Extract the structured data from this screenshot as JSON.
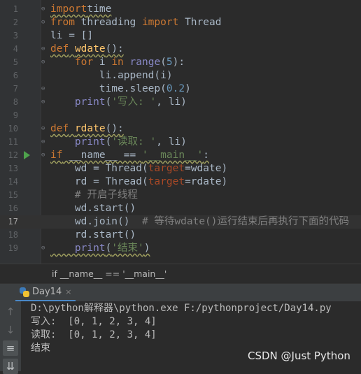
{
  "editor": {
    "lines": [
      {
        "n": "1",
        "segs": [
          [
            "kw",
            "import"
          ],
          [
            "",
            "time"
          ]
        ],
        "fold": true,
        "wavy": true
      },
      {
        "n": "2",
        "segs": [
          [
            "kw",
            "from"
          ],
          [
            "",
            " threading "
          ],
          [
            "kw",
            "import"
          ],
          [
            "",
            " Thread"
          ]
        ],
        "fold": true
      },
      {
        "n": "3",
        "segs": [
          [
            "",
            "li = []"
          ]
        ]
      },
      {
        "n": "4",
        "segs": [
          [
            "kw",
            "def"
          ],
          [
            "",
            " "
          ],
          [
            "fn",
            "wdate"
          ],
          [
            "",
            "():"
          ]
        ],
        "fold": true,
        "wavy": true
      },
      {
        "n": "5",
        "segs": [
          [
            "",
            "    "
          ],
          [
            "kw",
            "for"
          ],
          [
            "",
            " i "
          ],
          [
            "kw",
            "in"
          ],
          [
            "",
            " "
          ],
          [
            "bi",
            "range"
          ],
          [
            "",
            "("
          ],
          [
            "num",
            "5"
          ],
          [
            "",
            "):"
          ]
        ],
        "fold": true
      },
      {
        "n": "6",
        "segs": [
          [
            "",
            "        li.append(i)"
          ]
        ]
      },
      {
        "n": "7",
        "segs": [
          [
            "",
            "        time.sleep("
          ],
          [
            "num",
            "0.2"
          ],
          [
            "",
            ")"
          ]
        ],
        "fold": true
      },
      {
        "n": "8",
        "segs": [
          [
            "",
            "    "
          ],
          [
            "bi",
            "print"
          ],
          [
            "",
            "("
          ],
          [
            "str",
            "'写入: '"
          ],
          [
            "",
            ", li)"
          ]
        ],
        "fold": true
      },
      {
        "n": "9",
        "segs": []
      },
      {
        "n": "10",
        "segs": [
          [
            "kw",
            "def"
          ],
          [
            "",
            " "
          ],
          [
            "fn",
            "rdate"
          ],
          [
            "",
            "():"
          ]
        ],
        "fold": true,
        "wavy": true
      },
      {
        "n": "11",
        "segs": [
          [
            "",
            "    "
          ],
          [
            "bi",
            "print"
          ],
          [
            "",
            "("
          ],
          [
            "str",
            "'读取: '"
          ],
          [
            "",
            ", li)"
          ]
        ],
        "fold": true
      },
      {
        "n": "12",
        "segs": [
          [
            "kw",
            "if"
          ],
          [
            "",
            " __name__ == "
          ],
          [
            "str",
            "'__main__'"
          ],
          [
            "",
            ":"
          ]
        ],
        "fold": true,
        "wavy": true,
        "run": true
      },
      {
        "n": "13",
        "segs": [
          [
            "",
            "    wd = Thread("
          ],
          [
            "par",
            "target"
          ],
          [
            "",
            "=wdate)"
          ]
        ]
      },
      {
        "n": "14",
        "segs": [
          [
            "",
            "    rd = Thread("
          ],
          [
            "par",
            "target"
          ],
          [
            "",
            "=rdate)"
          ]
        ]
      },
      {
        "n": "15",
        "segs": [
          [
            "",
            "    "
          ],
          [
            "cmt",
            "# 开启子线程"
          ]
        ]
      },
      {
        "n": "16",
        "segs": [
          [
            "",
            "    wd.start()"
          ]
        ]
      },
      {
        "n": "17",
        "segs": [
          [
            "",
            "    wd.join()  "
          ],
          [
            "cmt",
            "# 等待wdate()运行结束后再执行下面的代码"
          ]
        ],
        "current": true
      },
      {
        "n": "18",
        "segs": [
          [
            "",
            "    rd.start()"
          ]
        ]
      },
      {
        "n": "19",
        "segs": [
          [
            "",
            "    "
          ],
          [
            "bi",
            "print"
          ],
          [
            "",
            "("
          ],
          [
            "str",
            "'结束'"
          ],
          [
            "",
            ")"
          ]
        ],
        "fold": true,
        "wavy": true
      }
    ]
  },
  "breadcrumb": "if __name__ == '__main__'",
  "run_panel": {
    "tab_label": "Day14",
    "tab_close": "×",
    "side_icons": [
      "arrow-up-icon",
      "arrow-down-icon",
      "soft-wrap-icon",
      "scroll-to-end-icon"
    ],
    "console_lines": [
      "D:\\python解释器\\python.exe F:/pythonproject/Day14.py",
      "写入:  [0, 1, 2, 3, 4]",
      "读取:  [0, 1, 2, 3, 4]",
      "结束"
    ]
  },
  "watermark": "CSDN @Just Python"
}
